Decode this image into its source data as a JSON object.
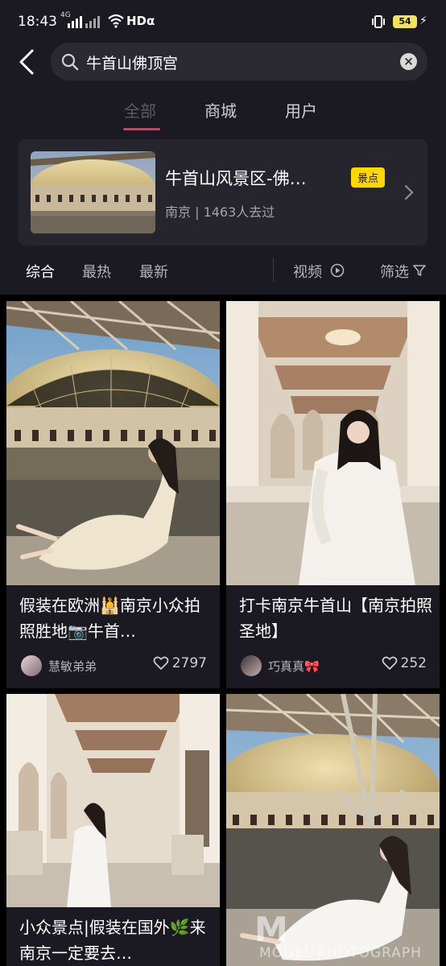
{
  "status_bar": {
    "time": "18:43",
    "network": "4G",
    "hd": "HDα",
    "battery": "54"
  },
  "search": {
    "query": "牛首山佛顶宫"
  },
  "tabs": [
    {
      "label": "全部",
      "active": true
    },
    {
      "label": "商城",
      "active": false
    },
    {
      "label": "用户",
      "active": false
    }
  ],
  "poi": {
    "name": "牛首山风景区-佛…",
    "badge": "景点",
    "meta": "南京 | 1463人去过"
  },
  "filters": {
    "items": [
      "综合",
      "最热",
      "最新"
    ],
    "video": "视频",
    "filter": "筛选"
  },
  "feed": [
    {
      "title": "假装在欧洲🕌南京小众拍照胜地📷牛首…",
      "author": "慧敏弟弟",
      "likes": "2797"
    },
    {
      "title": "打卡南京牛首山【南京拍照圣地】",
      "author": "巧真真🎀",
      "likes": "252"
    },
    {
      "title": "小众景点|假装在国外🌿来南京一定要去…",
      "author": "",
      "likes": ""
    },
    {
      "title": "",
      "author": "",
      "likes": ""
    }
  ],
  "watermark": {
    "big": "M",
    "small": "MODEL PHOTOGRAPH"
  },
  "colors": {
    "accent": "#fe2c55",
    "badge": "#ffd800",
    "background": "#1b1a22"
  }
}
